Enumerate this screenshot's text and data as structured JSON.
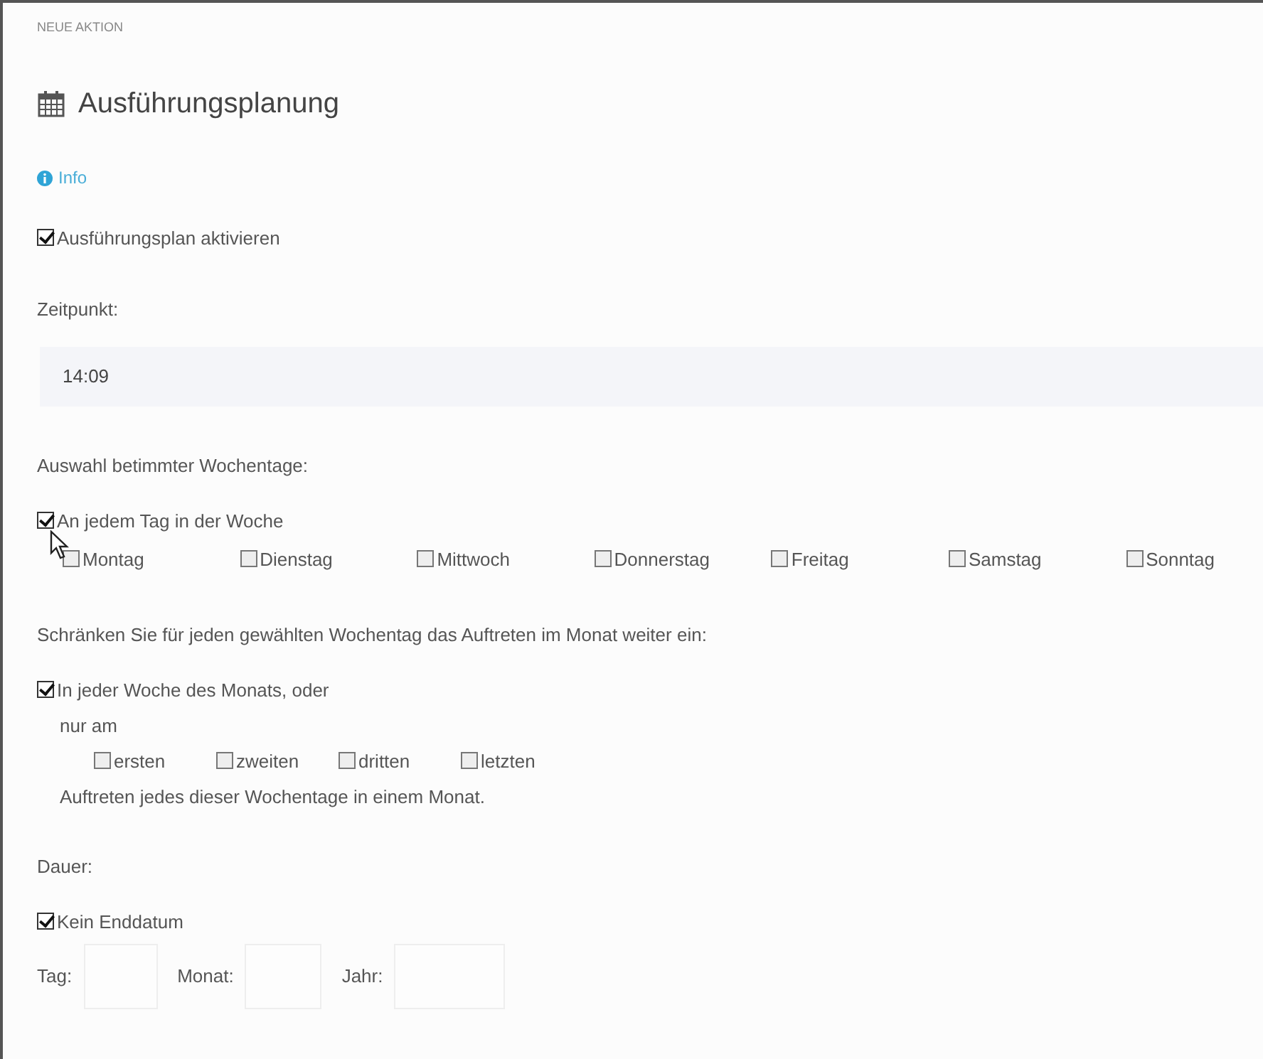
{
  "section_label": "NEUE AKTION",
  "title": "Ausführungsplanung",
  "info_link": "Info",
  "activate": {
    "label": "Ausführungsplan aktivieren",
    "checked": true
  },
  "time": {
    "label": "Zeitpunkt:",
    "value": "14:09"
  },
  "weekdays": {
    "label": "Auswahl betimmter Wochentage:",
    "every_day": {
      "label": "An jedem Tag in der Woche",
      "checked": true
    },
    "days": [
      {
        "label": "Montag",
        "checked": false
      },
      {
        "label": "Dienstag",
        "checked": false
      },
      {
        "label": "Mittwoch",
        "checked": false
      },
      {
        "label": "Donnerstag",
        "checked": false
      },
      {
        "label": "Freitag",
        "checked": false
      },
      {
        "label": "Samstag",
        "checked": false
      },
      {
        "label": "Sonntag",
        "checked": false
      }
    ]
  },
  "occurrence": {
    "label": "Schränken Sie für jeden gewählten Wochentag das Auftreten im Monat weiter ein:",
    "every_week": {
      "label": "In jeder Woche des Monats, oder",
      "checked": true
    },
    "only_label": "nur am",
    "ordinals": [
      {
        "label": "ersten",
        "checked": false
      },
      {
        "label": "zweiten",
        "checked": false
      },
      {
        "label": "dritten",
        "checked": false
      },
      {
        "label": "letzten",
        "checked": false
      }
    ],
    "suffix": "Auftreten jedes dieser Wochentage in einem Monat."
  },
  "duration": {
    "label": "Dauer:",
    "no_end": {
      "label": "Kein Enddatum",
      "checked": true
    },
    "fields": [
      {
        "label": "Tag:"
      },
      {
        "label": "Monat:"
      },
      {
        "label": "Jahr:"
      }
    ]
  }
}
